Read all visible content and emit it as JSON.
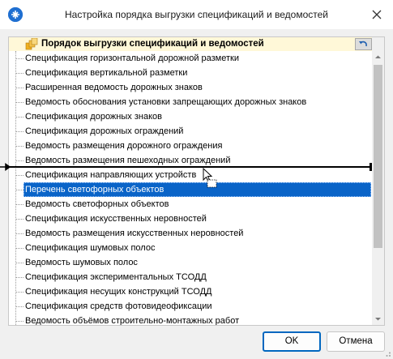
{
  "window": {
    "title": "Настройка порядка выгрузки спецификаций и ведомостей",
    "close_icon": "close-icon",
    "app_icon": "app-logo-icon"
  },
  "tree": {
    "header_label": "Порядок выгрузки спецификаций и ведомостей",
    "header_icon": "stack-icon",
    "reset_icon": "undo-icon",
    "selected_index": 9,
    "items": [
      {
        "label": "Спецификация горизонтальной дорожной разметки"
      },
      {
        "label": "Спецификация вертикальной разметки"
      },
      {
        "label": "Расширенная ведомость дорожных знаков"
      },
      {
        "label": "Ведомость обоснования установки запрещающих дорожных знаков"
      },
      {
        "label": "Спецификация дорожных знаков"
      },
      {
        "label": "Спецификация дорожных ограждений"
      },
      {
        "label": "Ведомость размещения дорожного ограждения"
      },
      {
        "label": "Ведомость размещения пешеходных ограждений"
      },
      {
        "label": "Спецификация направляющих устройств"
      },
      {
        "label": "Перечень светофорных объектов"
      },
      {
        "label": "Ведомость светофорных объектов"
      },
      {
        "label": "Спецификация искусственных неровностей"
      },
      {
        "label": "Ведомость размещения искусственных неровностей"
      },
      {
        "label": "Спецификация шумовых полос"
      },
      {
        "label": "Ведомость шумовых полос"
      },
      {
        "label": "Спецификация экспериментальных ТСОДД"
      },
      {
        "label": "Спецификация несущих конструкций ТСОДД"
      },
      {
        "label": "Спецификация средств фотовидеофиксации"
      },
      {
        "label": "Ведомость объёмов строительно-монтажных работ"
      }
    ]
  },
  "buttons": {
    "ok_label": "OK",
    "cancel_label": "Отмена"
  },
  "colors": {
    "selection": "#0a64c8",
    "header_bg": "#fff8d8",
    "default_button_border": "#0067c0"
  }
}
